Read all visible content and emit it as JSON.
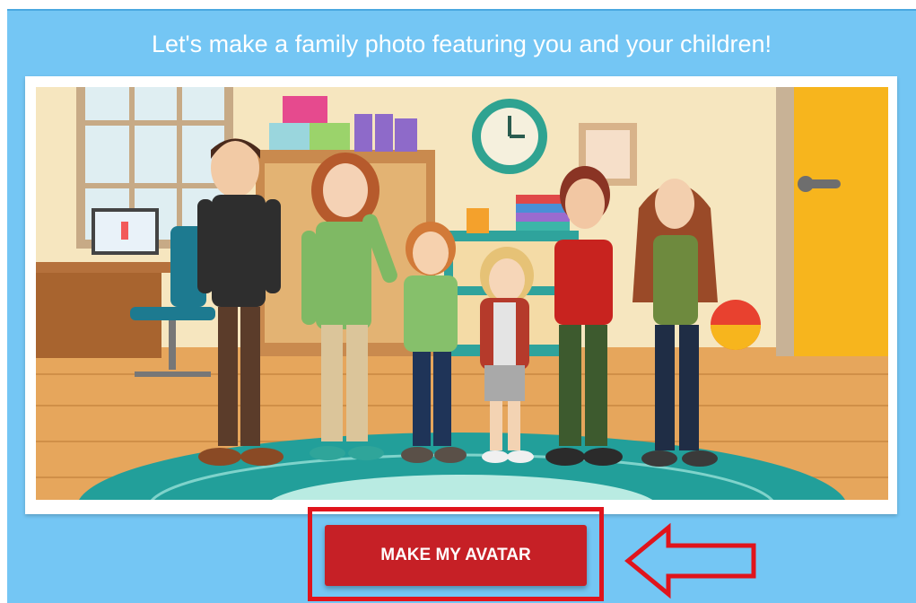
{
  "headline": "Let's make a family photo featuring you and your children!",
  "cta": {
    "label": "MAKE MY AVATAR"
  },
  "illustration": {
    "name": "family-avatar-illustration",
    "members": 6
  },
  "annotation": {
    "highlight_color": "#e0141c",
    "arrow_direction": "left"
  },
  "colors": {
    "background": "#74c6f4",
    "button": "#c62026",
    "button_text": "#ffffff"
  }
}
